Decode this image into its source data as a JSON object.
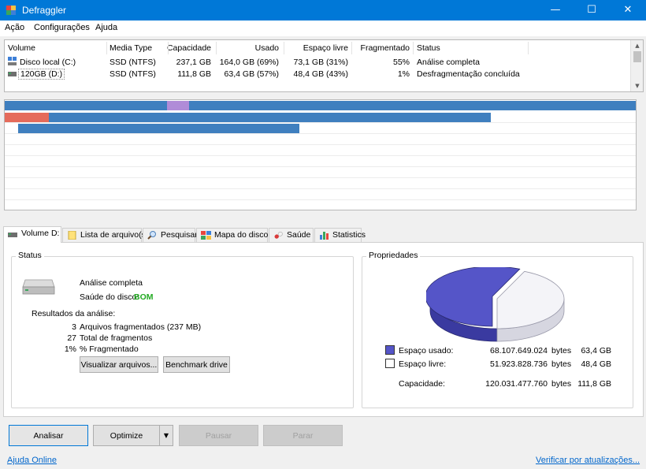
{
  "window": {
    "title": "Defraggler",
    "minimize": "—",
    "maximize": "☐",
    "close": "✕"
  },
  "menu": [
    "Ação",
    "Configurações",
    "Ajuda"
  ],
  "drives": {
    "headers": [
      "Volume",
      "Media Type",
      "Capacidade",
      "Usado",
      "Espaço livre",
      "Fragmentado",
      "Status"
    ],
    "rows": [
      {
        "volume": "Disco local (C:)",
        "media": "SSD (NTFS)",
        "capacity": "237,1 GB",
        "used": "164,0 GB (69%)",
        "free": "73,1 GB (31%)",
        "fragmented": "55%",
        "status": "Análise completa"
      },
      {
        "volume": "120GB (D:)",
        "media": "SSD (NTFS)",
        "capacity": "111,8 GB",
        "used": "63,4 GB (57%)",
        "free": "48,4 GB (43%)",
        "fragmented": "1%",
        "status": "Desfragmentação concluída"
      }
    ]
  },
  "tabs": [
    "Volume D:",
    "Lista de arquivo(s)",
    "Pesquisar",
    "Mapa do disco",
    "Saúde",
    "Statistics"
  ],
  "status": {
    "title": "Status",
    "state": "Análise completa",
    "health_label": "Saúde do disco:",
    "health_value": "BOM",
    "results_label": "Resultados da análise:",
    "results": [
      {
        "num": "3",
        "label": "Arquivos fragmentados (237 MB)"
      },
      {
        "num": "27",
        "label": "Total de fragmentos"
      },
      {
        "num": "1%",
        "label": "% Fragmentado"
      }
    ],
    "view_files_button": "Visualizar arquivos...",
    "benchmark_button": "Benchmark drive"
  },
  "properties": {
    "title": "Propriedades",
    "used_label": "Espaço usado:",
    "used_bytes": "68.107.649.024",
    "used_unit": "bytes",
    "used_gb": "63,4 GB",
    "free_label": "Espaço livre:",
    "free_bytes": "51.923.828.736",
    "free_unit": "bytes",
    "free_gb": "48,4 GB",
    "capacity_label": "Capacidade:",
    "capacity_bytes": "120.031.477.760",
    "capacity_unit": "bytes",
    "capacity_gb": "111,8 GB",
    "used_fraction": 0.567,
    "used_color": "#5555c8",
    "free_color": "#f4f4f8"
  },
  "actions": {
    "analyze": "Analisar",
    "optimize": "Optimize",
    "pause": "Pausar",
    "stop": "Parar"
  },
  "footer": {
    "help_link": "Ajuda Online",
    "update_link": "Verificar por atualizações..."
  },
  "colors": {
    "titlebar": "#0078d7",
    "map_used": "#3f7fbf",
    "map_fragmented": "#e56b5b",
    "map_highlight": "#b08cd8",
    "health_ok": "#22aa22",
    "link": "#0066cc"
  }
}
